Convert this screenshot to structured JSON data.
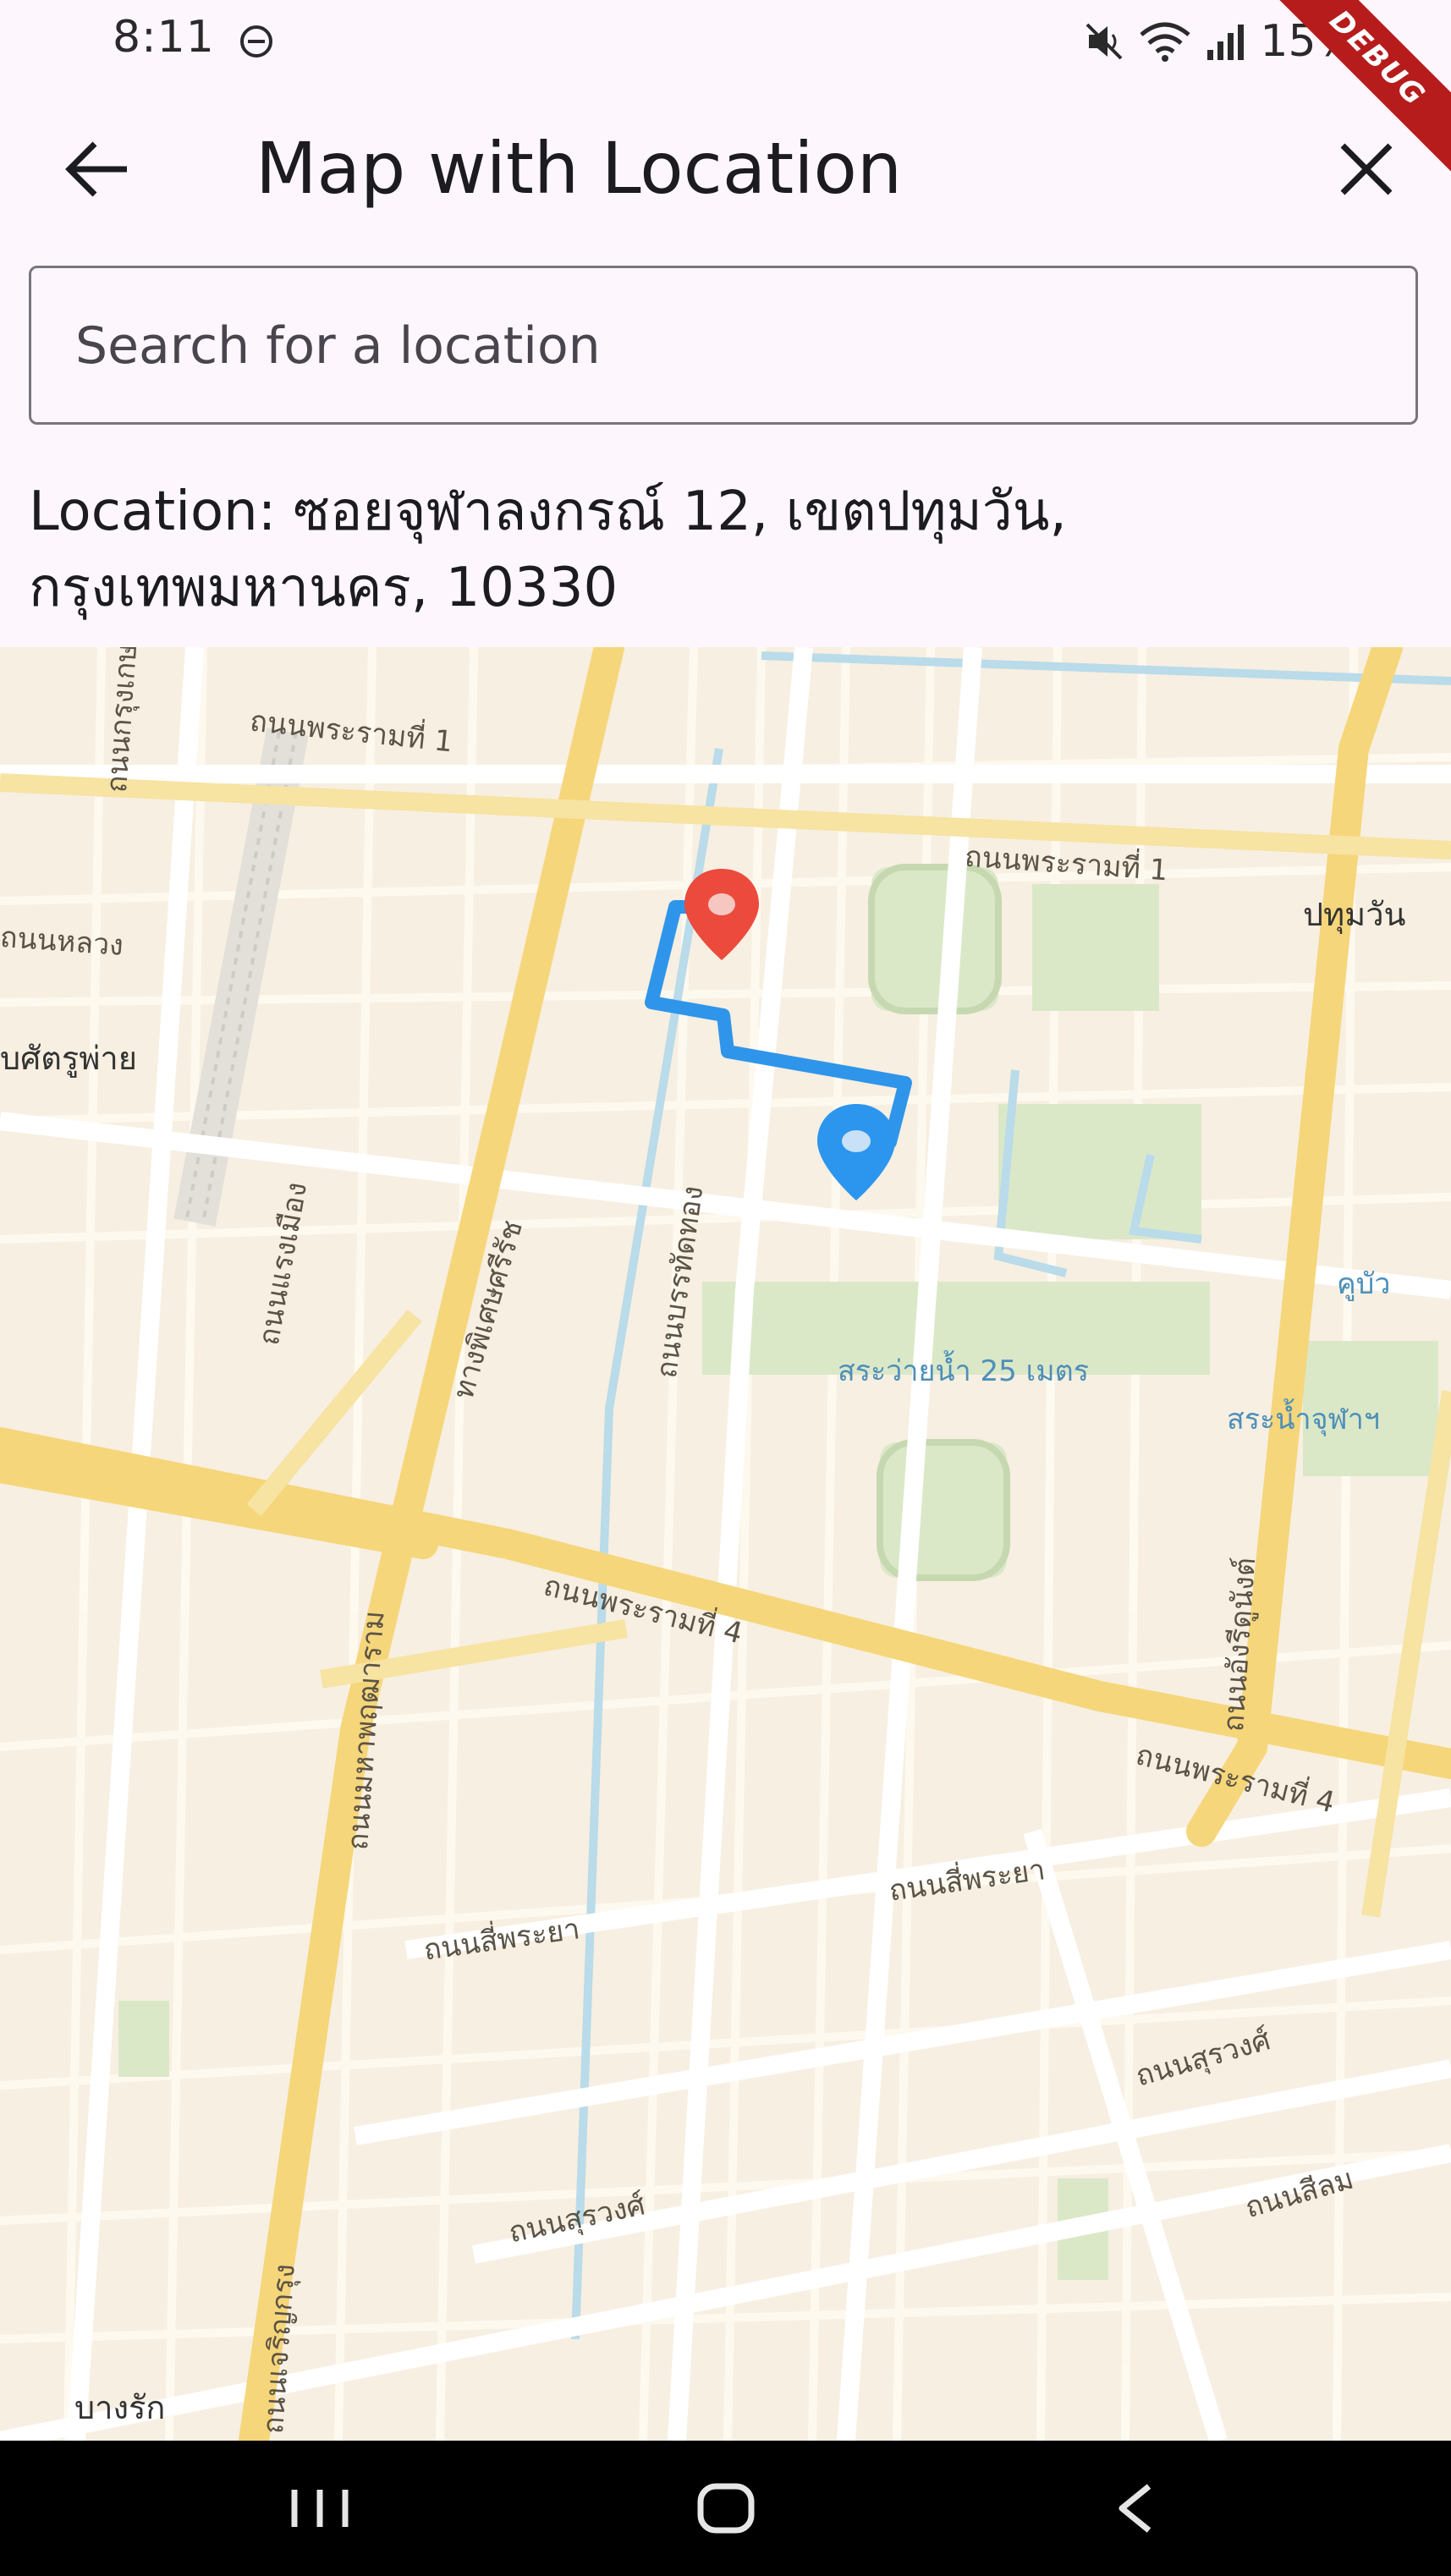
{
  "status_bar": {
    "time": "8:11",
    "battery": "15%",
    "icons": [
      "do-not-disturb-icon",
      "mute-icon",
      "wifi-icon",
      "signal-icon",
      "battery-icon"
    ]
  },
  "debug_banner": "DEBUG",
  "app_bar": {
    "title": "Map with Location",
    "back_icon": "arrow-back-icon",
    "close_icon": "close-icon"
  },
  "search": {
    "placeholder": "Search for a location",
    "value": ""
  },
  "location": {
    "text": "Location: ซอยจุฬาลงกรณ์ 12, เขตปทุมวัน, กรุงเทพมหานคร, 10330"
  },
  "map": {
    "labels": [
      "ถนนพระรามที่ 1",
      "ถนนพระรามที่ 1",
      "ปทุมวัน",
      "บศัตรูพ่าย",
      "ถนนหลวง",
      "ถนนกรุงเกษม",
      "ถนนแรงเมือง",
      "ทางพิเศษศรีรัช",
      "ถนนบรรทัดทอง",
      "สระว่ายน้ำ 25 เมตร",
      "คูบัว",
      "สระน้ำจุฬาฯ",
      "ถนนพระรามที่ 4",
      "ถนนพระรามที่ 4",
      "ถนนอังรีดูนังต์",
      "ถนนสี่พระยา",
      "ถนนสี่พระยา",
      "ถนนสุรวงศ์",
      "ถนนสุรวงศ์",
      "ถนนสีลม",
      "บางรัก",
      "ถนนมหาพฤฒาราม",
      "ถนนเจริญกรุง"
    ],
    "markers": {
      "destination": "red-location-pin-icon",
      "current": "blue-location-pin-icon"
    },
    "colors": {
      "route": "#2f95ea",
      "destination_pin": "#ec4a3c",
      "current_pin": "#2c95ee",
      "major_road": "#f6d67a",
      "park": "#dbe8c8",
      "water": "#b9dbea"
    }
  },
  "nav_bar": {
    "buttons": [
      "recent-apps-icon",
      "home-icon",
      "back-nav-icon"
    ]
  }
}
